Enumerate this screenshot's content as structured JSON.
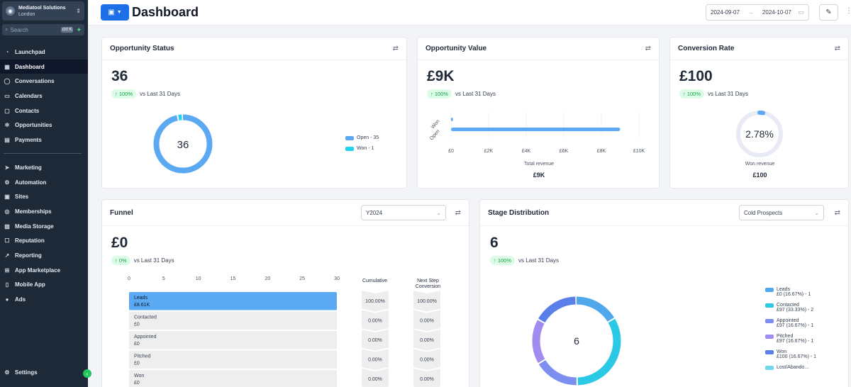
{
  "sidebar": {
    "account": {
      "name": "Mediatool Solutions",
      "location": "London"
    },
    "search": {
      "placeholder": "Search",
      "shortcut": "ctrl K"
    },
    "items": [
      {
        "label": "Launchpad",
        "icon": "rocket-icon"
      },
      {
        "label": "Dashboard",
        "icon": "dashboard-icon",
        "active": true
      },
      {
        "label": "Conversations",
        "icon": "chat-icon"
      },
      {
        "label": "Calendars",
        "icon": "calendar-icon"
      },
      {
        "label": "Contacts",
        "icon": "contacts-icon"
      },
      {
        "label": "Opportunities",
        "icon": "opportunities-icon"
      },
      {
        "label": "Payments",
        "icon": "payments-icon"
      }
    ],
    "items2": [
      {
        "label": "Marketing",
        "icon": "send-icon"
      },
      {
        "label": "Automation",
        "icon": "automation-icon"
      },
      {
        "label": "Sites",
        "icon": "sites-icon"
      },
      {
        "label": "Memberships",
        "icon": "memberships-icon"
      },
      {
        "label": "Media Storage",
        "icon": "media-icon"
      },
      {
        "label": "Reputation",
        "icon": "reputation-icon"
      },
      {
        "label": "Reporting",
        "icon": "reporting-icon"
      },
      {
        "label": "App Marketplace",
        "icon": "marketplace-icon"
      },
      {
        "label": "Mobile App",
        "icon": "mobile-icon"
      },
      {
        "label": "Ads",
        "icon": "ads-icon"
      }
    ],
    "settings": "Settings"
  },
  "header": {
    "title": "Dashboard",
    "date_from": "2024-09-07",
    "date_to": "2024-10-07"
  },
  "opportunity_status": {
    "title": "Opportunity Status",
    "value": "36",
    "trend": "↑ 100%",
    "trend_text": "vs Last 31 Days",
    "center": "36",
    "legend": [
      {
        "label": "Open - 35",
        "color": "#5aa9f2",
        "value": 35
      },
      {
        "label": "Won - 1",
        "color": "#22d3ee",
        "value": 1
      }
    ]
  },
  "opportunity_value": {
    "title": "Opportunity Value",
    "value": "£9K",
    "trend": "↑ 100%",
    "trend_text": "vs Last 31 Days",
    "footer_label": "Total revenue",
    "footer_value": "£9K"
  },
  "conversion_rate": {
    "title": "Conversion Rate",
    "value": "£100",
    "trend": "↑ 100%",
    "trend_text": "vs Last 31 Days",
    "center": "2.78%",
    "rate": 2.78,
    "footer_label": "Won revenue",
    "footer_value": "£100"
  },
  "funnel": {
    "title": "Funnel",
    "year": "Y2024",
    "value": "£0",
    "trend": "↑ 0%",
    "trend_text": "vs Last 31 Days",
    "cumulative_header": "Cumulative",
    "next_header": "Next Step Conversion",
    "ticks": [
      "0",
      "5",
      "10",
      "15",
      "20",
      "25",
      "30"
    ],
    "stages": [
      {
        "name": "Leads",
        "amount": "£8.61K",
        "count": 30,
        "cumulative": "100.00%",
        "next": "100.00%"
      },
      {
        "name": "Contacted",
        "amount": "£0",
        "count": 0,
        "cumulative": "0.00%",
        "next": "0.00%"
      },
      {
        "name": "Appointed",
        "amount": "£0",
        "count": 0,
        "cumulative": "0.00%",
        "next": "0.00%"
      },
      {
        "name": "Pitched",
        "amount": "£0",
        "count": 0,
        "cumulative": "0.00%",
        "next": "0.00%"
      },
      {
        "name": "Won",
        "amount": "£0",
        "count": 0,
        "cumulative": "0.00%",
        "next": "0.00%"
      }
    ]
  },
  "stage_distribution": {
    "title": "Stage Distribution",
    "pipeline": "Cold Prospects",
    "value": "6",
    "trend": "↑ 100%",
    "trend_text": "vs Last 31 Days",
    "center": "6",
    "legend": [
      {
        "name": "Leads",
        "detail": "£0 (16.67%) - 1",
        "color": "#4fa8ec",
        "value": 1
      },
      {
        "name": "Contacted",
        "detail": "£97 (33.33%) - 2",
        "color": "#2cc9e6",
        "value": 2
      },
      {
        "name": "Appointed",
        "detail": "£97 (16.67%) - 1",
        "color": "#7c8ff0",
        "value": 1
      },
      {
        "name": "Pitched",
        "detail": "£97 (16.67%) - 1",
        "color": "#a08cf0",
        "value": 1
      },
      {
        "name": "Won",
        "detail": "£100 (16.67%) - 1",
        "color": "#5b7fe8",
        "value": 1
      },
      {
        "name": "Lost/Abando...",
        "detail": "",
        "color": "#6fd8ee",
        "value": 0
      }
    ]
  },
  "chart_data": [
    {
      "type": "pie",
      "title": "Opportunity Status",
      "categories": [
        "Open",
        "Won"
      ],
      "values": [
        35,
        1
      ]
    },
    {
      "type": "bar",
      "title": "Opportunity Value",
      "categories": [
        "Won",
        "Open"
      ],
      "values": [
        100,
        9000
      ],
      "xlabel": "Total revenue",
      "xlim": [
        0,
        10000
      ],
      "ticks": [
        "£0",
        "£2K",
        "£4K",
        "£6K",
        "£8K",
        "£10K"
      ]
    },
    {
      "type": "bar",
      "title": "Funnel",
      "categories": [
        "Leads",
        "Contacted",
        "Appointed",
        "Pitched",
        "Won"
      ],
      "values": [
        30,
        0,
        0,
        0,
        0
      ],
      "xlim": [
        0,
        30
      ]
    },
    {
      "type": "pie",
      "title": "Stage Distribution",
      "categories": [
        "Leads",
        "Contacted",
        "Appointed",
        "Pitched",
        "Won"
      ],
      "values": [
        1,
        2,
        1,
        1,
        1
      ]
    }
  ]
}
